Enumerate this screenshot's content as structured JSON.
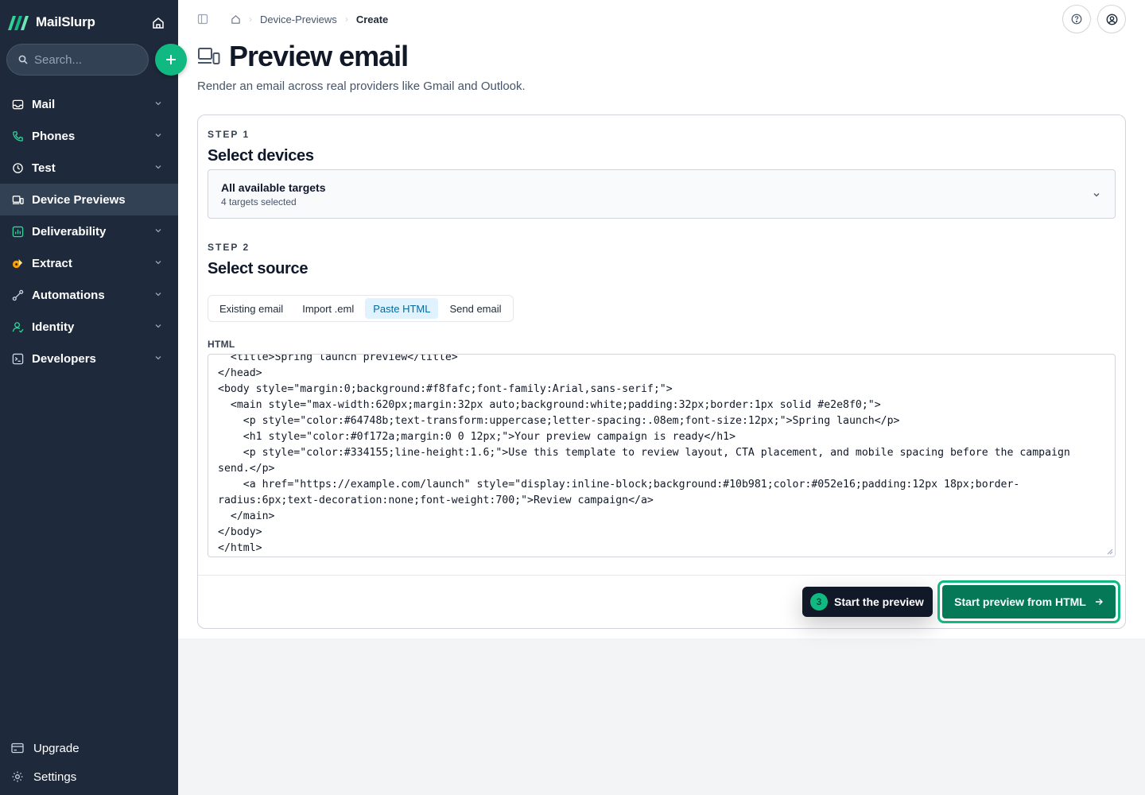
{
  "app": {
    "name": "MailSlurp",
    "accent": "#10b981",
    "sidebar_bg": "#1e293b"
  },
  "sidebar": {
    "search_placeholder": "Search...",
    "items": [
      {
        "label": "Mail",
        "icon": "inbox-icon",
        "expandable": true
      },
      {
        "label": "Phones",
        "icon": "phone-icon",
        "expandable": true
      },
      {
        "label": "Test",
        "icon": "clock-icon",
        "expandable": true
      },
      {
        "label": "Device Previews",
        "icon": "devices-icon",
        "expandable": false,
        "active": true
      },
      {
        "label": "Deliverability",
        "icon": "chart-icon",
        "expandable": true
      },
      {
        "label": "Extract",
        "icon": "extract-icon",
        "expandable": true
      },
      {
        "label": "Automations",
        "icon": "automation-icon",
        "expandable": true
      },
      {
        "label": "Identity",
        "icon": "identity-icon",
        "expandable": true
      },
      {
        "label": "Developers",
        "icon": "terminal-icon",
        "expandable": true
      }
    ],
    "bottom": [
      {
        "label": "Upgrade",
        "icon": "card-icon"
      },
      {
        "label": "Settings",
        "icon": "gear-icon"
      }
    ]
  },
  "breadcrumb": {
    "section": "Device-Previews",
    "current": "Create"
  },
  "page": {
    "title": "Preview email",
    "subtitle": "Render an email across real providers like Gmail and Outlook."
  },
  "step1": {
    "label": "STEP 1",
    "title": "Select devices",
    "select_value": "All available targets",
    "select_sub": "4 targets selected"
  },
  "step2": {
    "label": "STEP 2",
    "title": "Select source",
    "tabs": [
      "Existing email",
      "Import .eml",
      "Paste HTML",
      "Send email"
    ],
    "active_tab": "Paste HTML",
    "html_label": "HTML",
    "html_value": "  <title>Spring launch preview</title>\n</head>\n<body style=\"margin:0;background:#f8fafc;font-family:Arial,sans-serif;\">\n  <main style=\"max-width:620px;margin:32px auto;background:white;padding:32px;border:1px solid #e2e8f0;\">\n    <p style=\"color:#64748b;text-transform:uppercase;letter-spacing:.08em;font-size:12px;\">Spring launch</p>\n    <h1 style=\"color:#0f172a;margin:0 0 12px;\">Your preview campaign is ready</h1>\n    <p style=\"color:#334155;line-height:1.6;\">Use this template to review layout, CTA placement, and mobile spacing before the campaign send.</p>\n    <a href=\"https://example.com/launch\" style=\"display:inline-block;background:#10b981;color:#052e16;padding:12px 18px;border-radius:6px;text-decoration:none;font-weight:700;\">Review campaign</a>\n  </main>\n</body>\n</html>"
  },
  "tour": {
    "step_number": "3",
    "text": "Start the preview"
  },
  "actions": {
    "primary": "Start preview from HTML"
  }
}
